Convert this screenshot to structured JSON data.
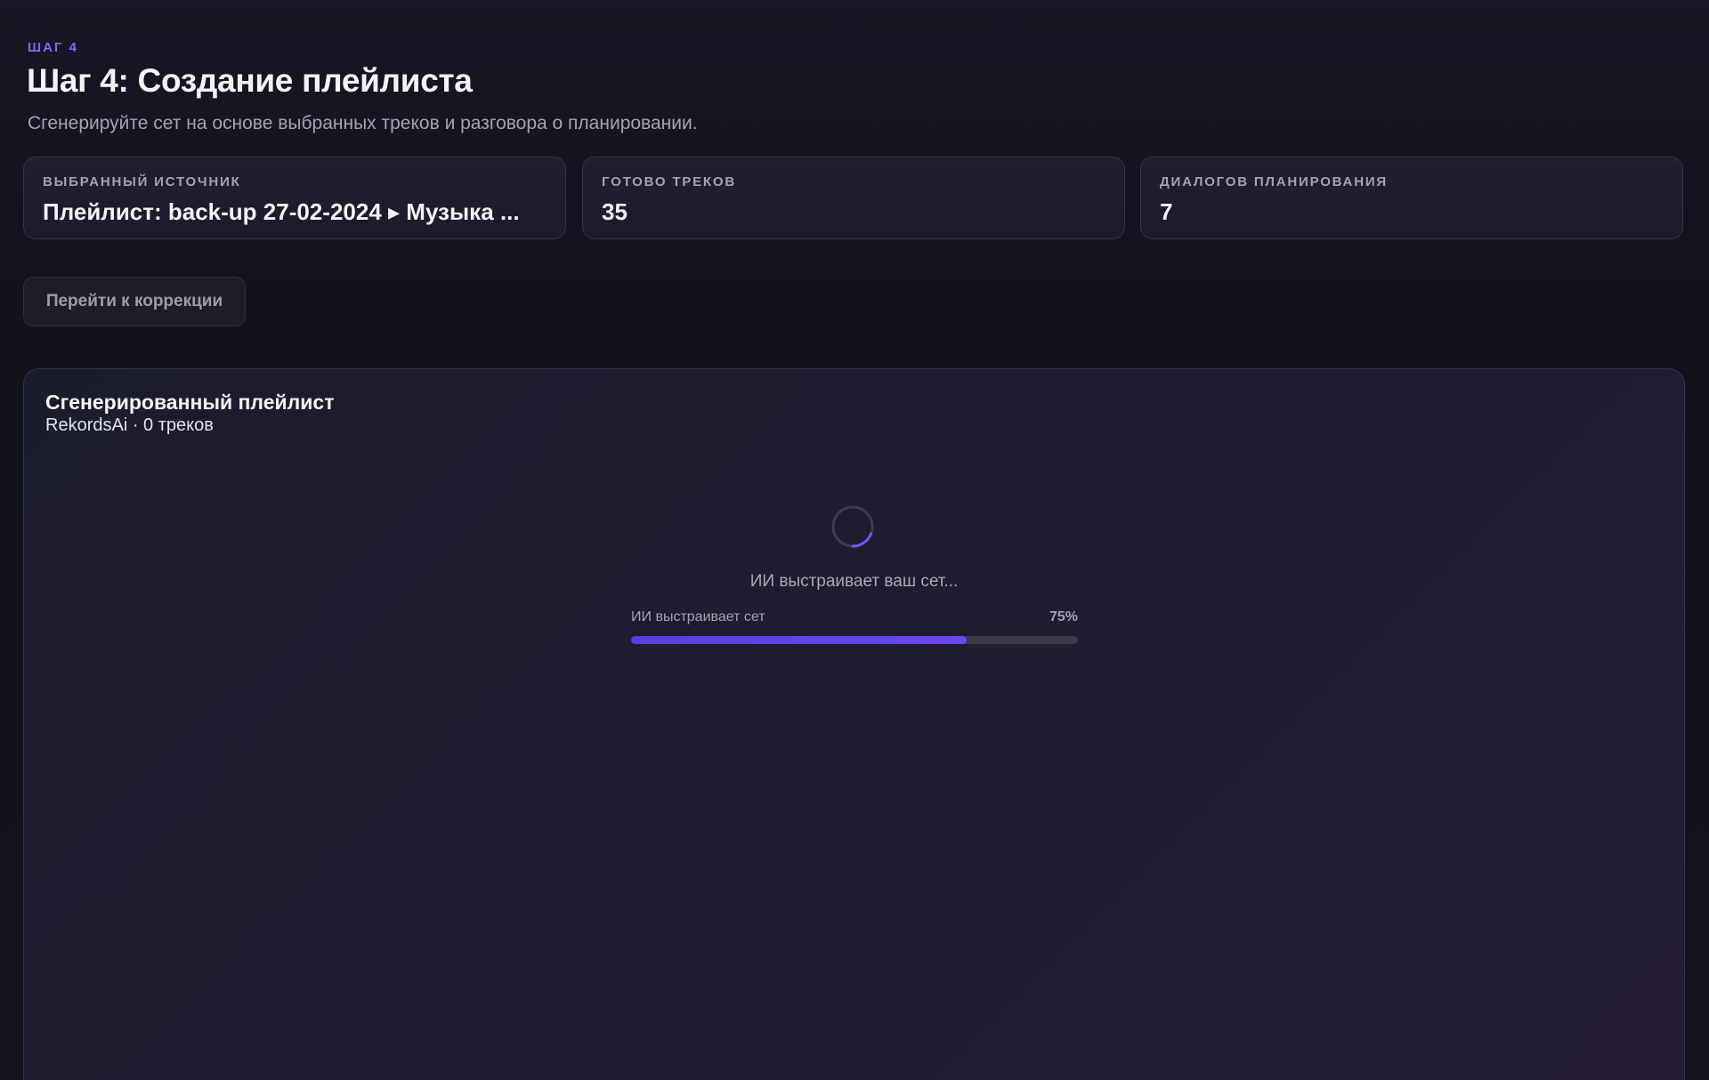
{
  "step": {
    "eyebrow": "ШАГ 4",
    "title": "Шаг 4: Создание плейлиста",
    "subtitle": "Сгенерируйте сет на основе выбранных треков и разговора о планировании."
  },
  "stats": [
    {
      "label": "ВЫБРАННЫЙ ИСТОЧНИК",
      "value": "Плейлист: back-up 27-02-2024 ▸ Музыка ..."
    },
    {
      "label": "ГОТОВО ТРЕКОВ",
      "value": "35"
    },
    {
      "label": "ДИАЛОГОВ ПЛАНИРОВАНИЯ",
      "value": "7"
    }
  ],
  "actions": {
    "go_to_correction": "Перейти к коррекции"
  },
  "playlist": {
    "title": "Сгенерированный плейлист",
    "meta": "RekordsAi · 0 треков",
    "loading_text": "ИИ выстраивает ваш сет...",
    "progress_label": "ИИ выстраивает сет",
    "progress_percent_text": "75%",
    "progress_value": 0.75
  },
  "colors": {
    "accent": "#8b63f5",
    "progress_fill": "#6b47f2",
    "background": "#12121d"
  },
  "icons": {
    "spinner": "loading-spinner-icon"
  }
}
